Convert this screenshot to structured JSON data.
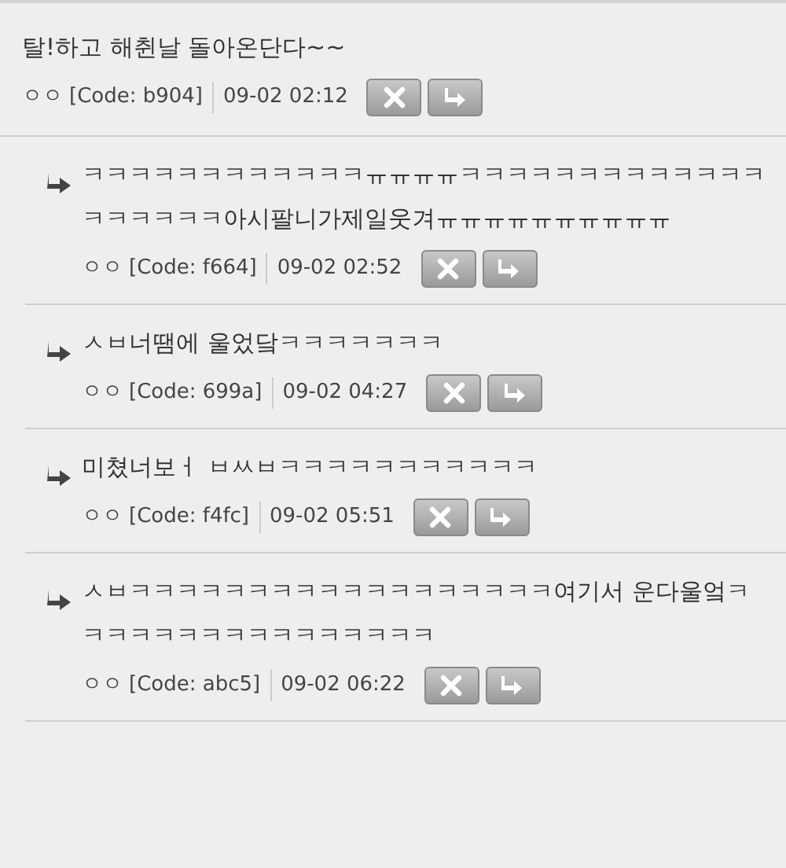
{
  "comment": {
    "text": "탈!하고 해췬날 돌아온단다~~",
    "author": "ㅇㅇ",
    "code": "[Code: b904]",
    "time": "09-02 02:12"
  },
  "replies": [
    {
      "text": "ㅋㅋㅋㅋㅋㅋㅋㅋㅋㅋㅋㅋㅠㅠㅠㅠㅋㅋㅋㅋㅋㅋㅋㅋㅋㅋㅋㅋㅋㅋㅋㅋㅋㅋㅋ아시팔니가제일웃겨ㅠㅠㅠㅠㅠㅠㅠㅠㅠㅠ",
      "author": "ㅇㅇ",
      "code": "[Code: f664]",
      "time": "09-02 02:52"
    },
    {
      "text": "ㅅㅂ너땜에 울었닼ㅋㅋㅋㅋㅋㅋㅋ",
      "author": "ㅇㅇ",
      "code": "[Code: 699a]",
      "time": "09-02 04:27"
    },
    {
      "text": "미쳤너보ㅓ ㅂㅆㅂㅋㅋㅋㅋㅋㅋㅋㅋㅋㅋㅋ",
      "author": "ㅇㅇ",
      "code": "[Code: f4fc]",
      "time": "09-02 05:51"
    },
    {
      "text": "ㅅㅂㅋㅋㅋㅋㅋㅋㅋㅋㅋㅋㅋㅋㅋㅋㅋㅋㅋㅋ여기서 운다울엌ㅋㅋㅋㅋㅋㅋㅋㅋㅋㅋㅋㅋㅋㅋㅋㅋ",
      "author": "ㅇㅇ",
      "code": "[Code: abc5]",
      "time": "09-02 06:22"
    }
  ]
}
